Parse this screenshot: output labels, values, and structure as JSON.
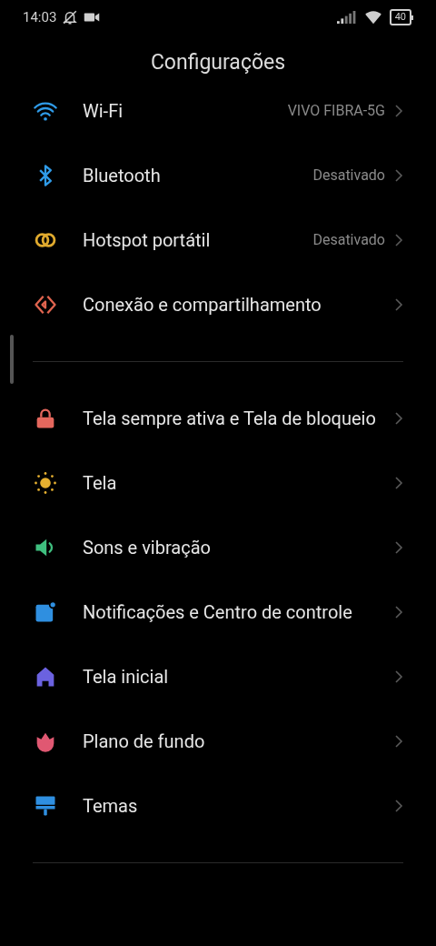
{
  "status_bar": {
    "time": "14:03",
    "battery": "40"
  },
  "title": "Configurações",
  "sections": [
    {
      "items": [
        {
          "label": "Wi-Fi",
          "value": "VIVO FIBRA-5G"
        },
        {
          "label": "Bluetooth",
          "value": "Desativado"
        },
        {
          "label": "Hotspot portátil",
          "value": "Desativado"
        },
        {
          "label": "Conexão e compartilhamento"
        }
      ]
    },
    {
      "items": [
        {
          "label": "Tela sempre ativa e Tela de bloqueio"
        },
        {
          "label": "Tela"
        },
        {
          "label": "Sons e vibração"
        },
        {
          "label": "Notificações e Centro de controle"
        },
        {
          "label": "Tela inicial"
        },
        {
          "label": "Plano de fundo"
        },
        {
          "label": "Temas"
        }
      ]
    }
  ]
}
